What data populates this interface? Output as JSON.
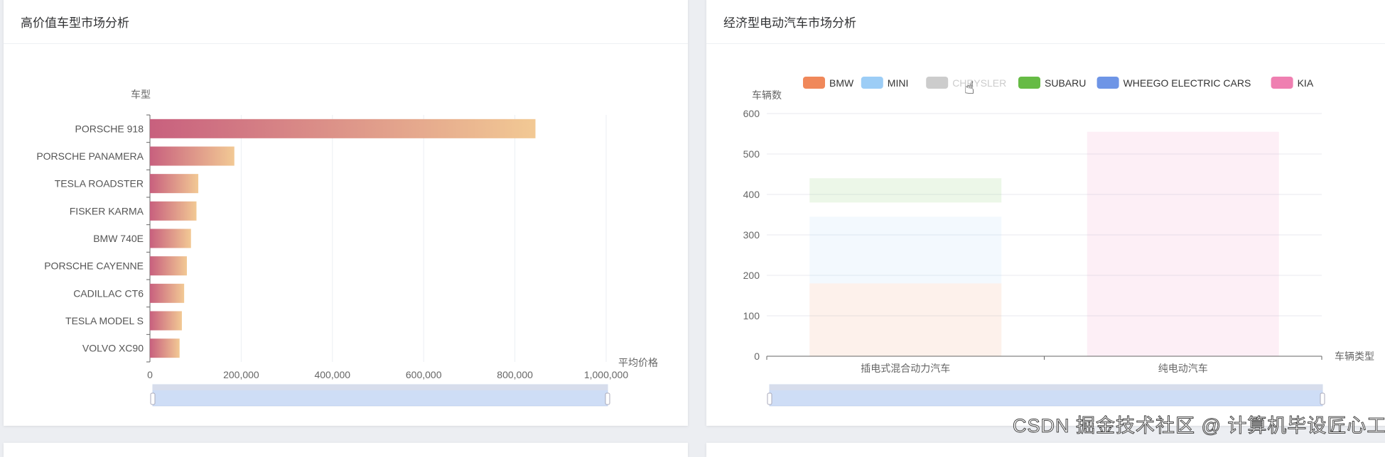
{
  "cards": [
    {
      "title": "高价值车型市场分析"
    },
    {
      "title": "经济型电动汽车市场分析"
    }
  ],
  "watermark": "CSDN 掘金技术社区 @ 计算机毕设匠心工作室",
  "chart_data": [
    {
      "type": "bar",
      "orientation": "horizontal",
      "title": "高价值车型市场分析",
      "xlabel": "平均价格",
      "ylabel": "车型",
      "categories": [
        "PORSCHE 918",
        "PORSCHE PANAMERA",
        "TESLA ROADSTER",
        "FISKER KARMA",
        "BMW 740E",
        "PORSCHE CAYENNE",
        "CADILLAC CT6",
        "TESLA MODEL S",
        "VOLVO XC90"
      ],
      "values": [
        845000,
        185000,
        106000,
        102000,
        90000,
        81000,
        75000,
        70000,
        65000
      ],
      "xlim": [
        0,
        1000000
      ],
      "xticks": [
        "0",
        "200,000",
        "400,000",
        "600,000",
        "800,000",
        "1,000,000"
      ],
      "grid": true,
      "gradient": [
        "#c8607e",
        "#f2c994"
      ],
      "datazoom": true
    },
    {
      "type": "bar",
      "stacked": true,
      "title": "经济型电动汽车市场分析",
      "xlabel": "车辆类型",
      "ylabel": "车辆数",
      "categories": [
        "插电式混合动力汽车",
        "纯电动汽车"
      ],
      "ylim": [
        0,
        600
      ],
      "yticks": [
        "0",
        "100",
        "200",
        "300",
        "400",
        "500",
        "600"
      ],
      "legend_position": "top",
      "series": [
        {
          "name": "BMW",
          "color": "#f0885a",
          "values": [
            180,
            0
          ],
          "visible": true
        },
        {
          "name": "MINI",
          "color": "#9ccdf6",
          "values": [
            165,
            0
          ],
          "visible": true
        },
        {
          "name": "CHRYSLER",
          "color": "#cccccc",
          "values": [
            35,
            0
          ],
          "visible": false
        },
        {
          "name": "SUBARU",
          "color": "#66bb45",
          "values": [
            60,
            0
          ],
          "visible": true
        },
        {
          "name": "WHEEGO ELECTRIC CARS",
          "color": "#6e95e6",
          "values": [
            0,
            0
          ],
          "visible": true
        },
        {
          "name": "KIA",
          "color": "#ef7fb1",
          "values": [
            0,
            555
          ],
          "visible": true
        }
      ],
      "grid": true,
      "datazoom": true
    }
  ]
}
